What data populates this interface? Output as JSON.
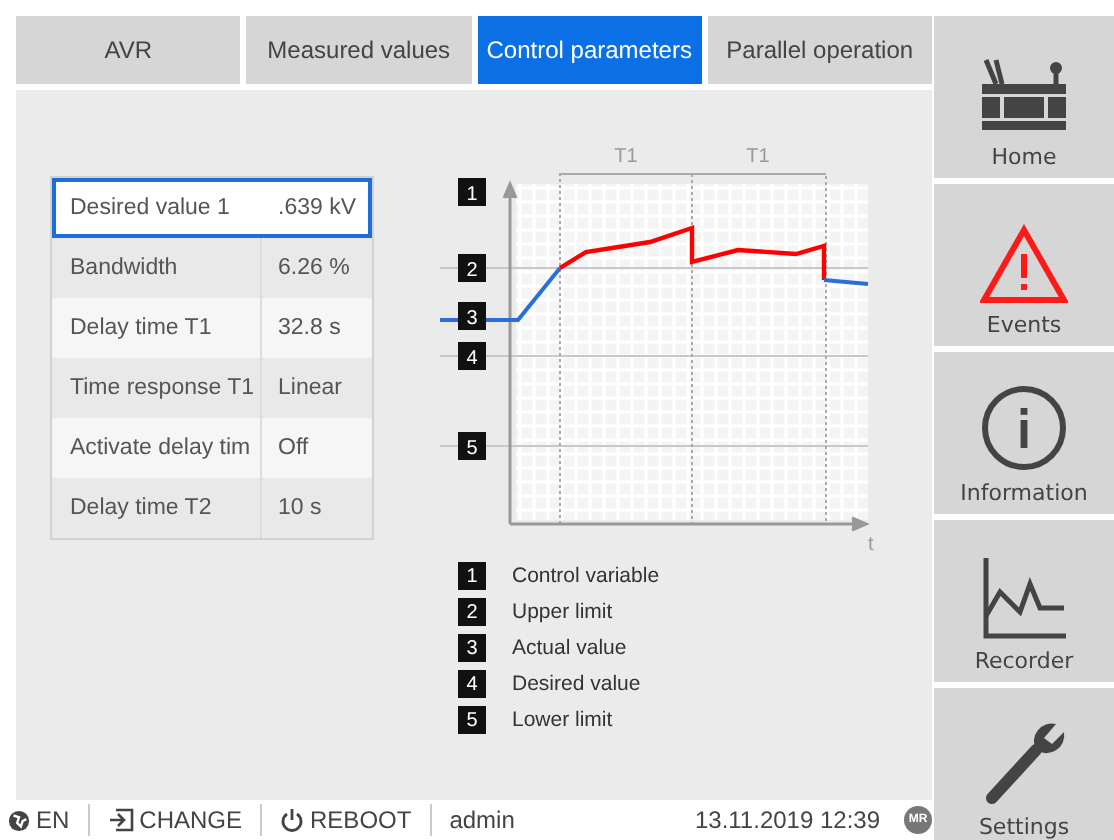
{
  "tabs": [
    {
      "label": "AVR",
      "selected": false
    },
    {
      "label": "Measured values",
      "selected": false
    },
    {
      "label": "Control parameters",
      "selected": true
    },
    {
      "label": "Parallel operation",
      "selected": false
    }
  ],
  "parameters": [
    {
      "name": "Desired value 1",
      "value": ".639 kV",
      "selected": true
    },
    {
      "name": "Bandwidth",
      "value": "6.26 %",
      "selected": false
    },
    {
      "name": "Delay time T1",
      "value": "32.8 s",
      "selected": false
    },
    {
      "name": "Time response T1",
      "value": "Linear",
      "selected": false
    },
    {
      "name": "Activate delay tim",
      "value": "Off",
      "selected": false
    },
    {
      "name": "Delay time T2",
      "value": "10 s",
      "selected": false
    }
  ],
  "diagram": {
    "markers": [
      "1",
      "2",
      "3",
      "4",
      "5"
    ],
    "interval_labels": [
      "T1",
      "T1"
    ],
    "axis_label": "t"
  },
  "legend": [
    {
      "number": "1",
      "label": "Control variable"
    },
    {
      "number": "2",
      "label": "Upper limit"
    },
    {
      "number": "3",
      "label": "Actual value"
    },
    {
      "number": "4",
      "label": "Desired value"
    },
    {
      "number": "5",
      "label": "Lower limit"
    }
  ],
  "sidebar": [
    {
      "kind": "home",
      "label": "Home"
    },
    {
      "kind": "events",
      "label": "Events"
    },
    {
      "kind": "information",
      "label": "Information"
    },
    {
      "kind": "recorder",
      "label": "Recorder"
    },
    {
      "kind": "settings",
      "label": "Settings"
    }
  ],
  "status_bar": {
    "language": "EN",
    "change": "CHANGE",
    "reboot": "REBOOT",
    "user": "admin",
    "datetime": "13.11.2019 12:39",
    "logo": "MR"
  }
}
